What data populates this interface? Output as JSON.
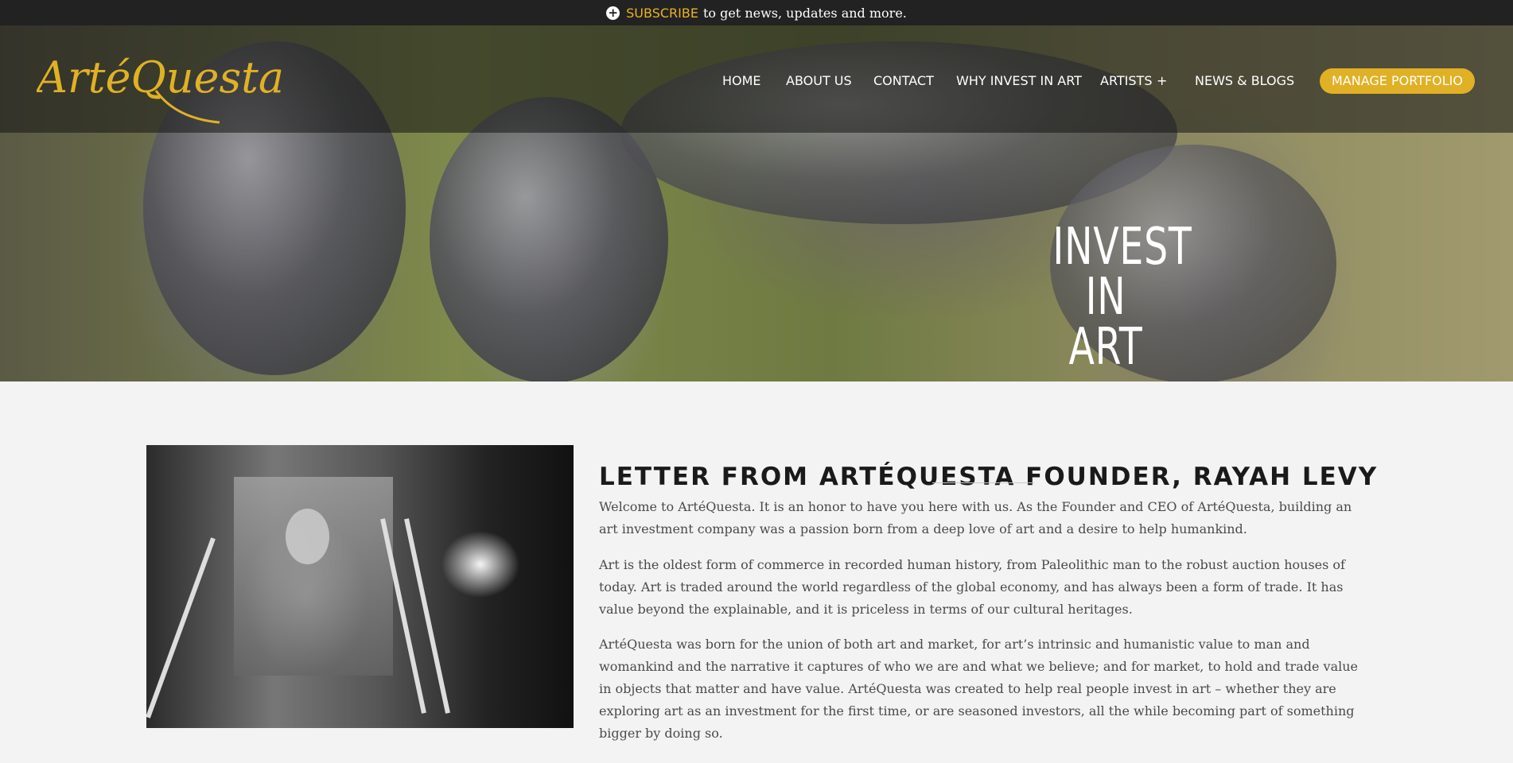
{
  "topbar": {
    "plus_icon": "plus-circle-icon",
    "subscribe": "SUBSCRIBE",
    "rest": "to get news, updates and more."
  },
  "logo": {
    "text": "ArtéQuesta"
  },
  "nav": {
    "items": [
      "HOME",
      "ABOUT US",
      "CONTACT",
      "WHY INVEST IN ART",
      "ARTISTS",
      "NEWS & BLOGS"
    ],
    "artists_expand": "+",
    "cta": "MANAGE PORTFOLIO"
  },
  "hero": {
    "line1": "INVEST",
    "line2": "IN ART"
  },
  "letter": {
    "title": "LETTER FROM ARTÉQUESTA FOUNDER, RAYAH LEVY",
    "paragraphs": [
      "Welcome to ArtéQuesta. It is an honor to have you here with us. As the Founder and CEO of ArtéQuesta, building an art investment company was a passion born from a deep love of art and a desire to help humankind.",
      "Art is the oldest form of commerce in recorded human history, from Paleolithic man to the robust auction houses of today. Art is traded around the world regardless of the global economy, and has always been a form of trade. It has value beyond the explainable, and it is priceless in terms of our cultural heritages.",
      "ArtéQuesta was born for the union of both art and market, for art’s intrinsic and humanistic value to man and womankind and the narrative it captures of who we are and what we believe; and for market, to hold and trade value in objects that matter and have value. ArtéQuesta was created to help real people invest in art – whether they are exploring art as an investment for the first time, or are seasoned investors, all the while becoming part of something bigger by doing so."
    ]
  },
  "colors": {
    "accent": "#e0b125",
    "topbar_bg": "#222222",
    "page_bg": "#f3f3f3"
  }
}
